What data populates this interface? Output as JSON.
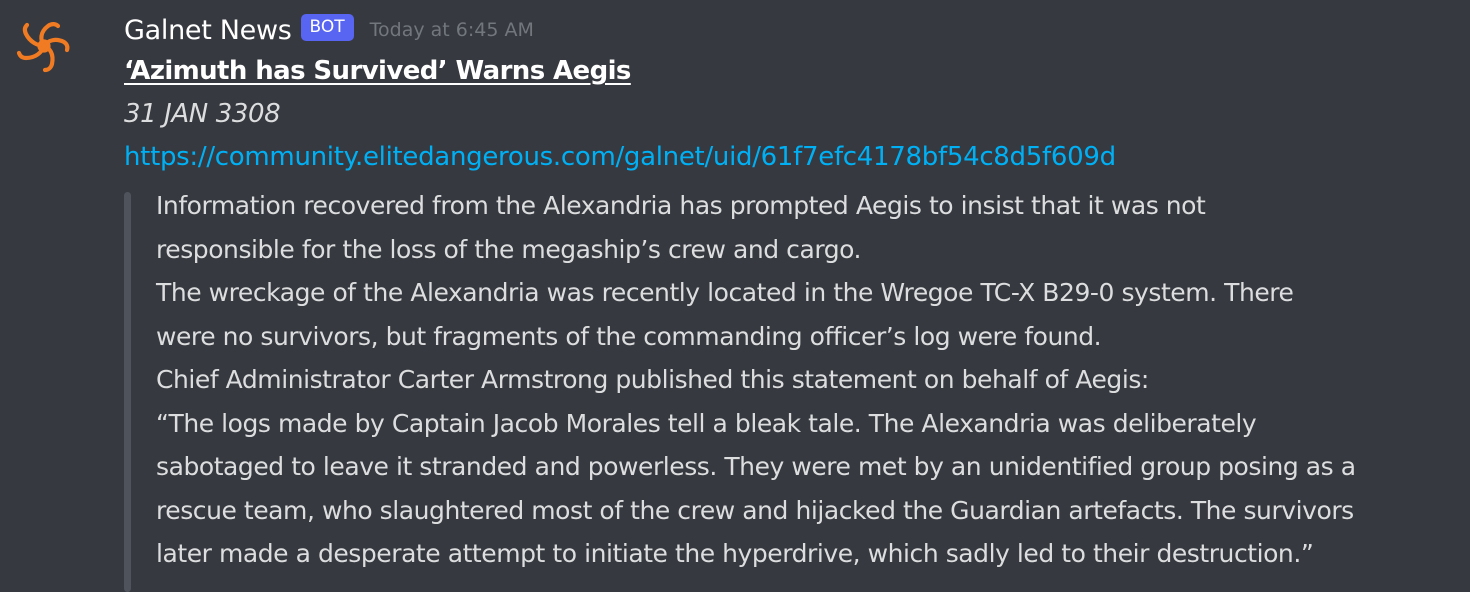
{
  "message": {
    "author": "Galnet News",
    "bot_tag": "BOT",
    "timestamp": "Today at 6:45 AM",
    "title": "‘Azimuth has Survived’ Warns Aegis",
    "date": "31 JAN 3308",
    "link": "https://community.elitedangerous.com/galnet/uid/61f7efc4178bf54c8d5f609d",
    "quote_lines": [
      "Information recovered from the Alexandria has prompted Aegis to insist that it was not",
      "responsible for the loss of the megaship’s crew and cargo.",
      "The wreckage of the Alexandria was recently located in the Wregoe TC-X B29-0 system. There",
      "were no survivors, but fragments of the commanding officer’s log were found.",
      "Chief Administrator Carter Armstrong published this statement on behalf of Aegis:",
      "“The logs made by Captain Jacob Morales tell a bleak tale. The Alexandria was deliberately",
      "sabotaged to leave it stranded and powerless. They were met by an unidentified group posing as a",
      "rescue team, who slaughtered most of the crew and hijacked the Guardian artefacts. The survivors",
      "later made a desperate attempt to initiate the hyperdrive, which sadly led to their destruction.”"
    ]
  },
  "avatar_icon": "orange-spiral-logo-icon",
  "colors": {
    "background": "#36393f",
    "bot_tag": "#5865f2",
    "link": "#00b0f4",
    "avatar_orange": "#f07b22"
  }
}
